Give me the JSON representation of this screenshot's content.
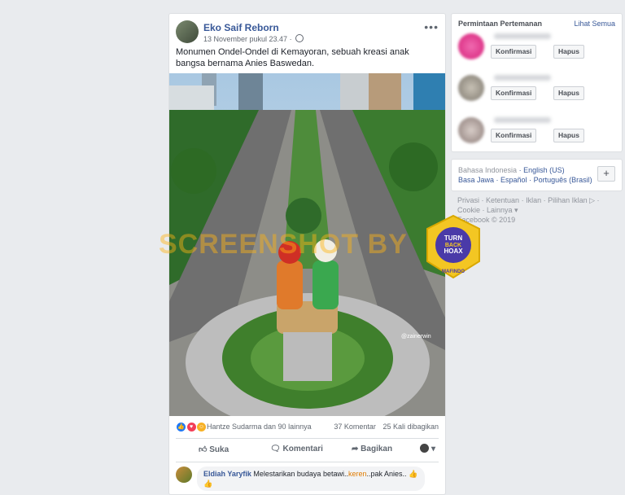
{
  "post": {
    "author": "Eko Saif Reborn",
    "timestamp": "13 November pukul 23.47 ·",
    "more_icon": "more-dots-icon",
    "text": "Monumen Ondel-Ondel di Kemayoran, sebuah kreasi anak bangsa bernama Anies Baswedan.",
    "photo_credit": "@zainerwin",
    "reactions": {
      "names": "Hantze Sudarma dan 90 lainnya",
      "comments": "37 Komentar",
      "shares": "25 Kali dibagikan"
    },
    "actions": {
      "like": "Suka",
      "comment": "Komentari",
      "share": "Bagikan"
    },
    "comment": {
      "author": "Eldiah Yaryfik",
      "text_before": "Melestarikan budaya betawi..",
      "keyword": "keren",
      "text_after": "..pak Anies.."
    }
  },
  "friend_requests": {
    "title": "Permintaan Pertemanan",
    "see_all": "Lihat Semua",
    "confirm_label": "Konfirmasi",
    "delete_label": "Hapus"
  },
  "languages": {
    "current": "Bahasa Indonesia",
    "items": [
      "English (US)",
      "Basa Jawa",
      "Español",
      "Português (Brasil)"
    ],
    "plus": "+"
  },
  "footer": {
    "links": [
      "Privasi",
      "Ketentuan",
      "Iklan",
      "Pilihan Iklan",
      "Cookie",
      "Lainnya"
    ],
    "copyright": "Facebook © 2019"
  },
  "overlay": {
    "watermark": "SCREENSHOT BY",
    "badge_line1": "TURN",
    "badge_line2": "BACK",
    "badge_line3": "HOAX",
    "badge_org": "MAFINDO"
  },
  "colors": {
    "fb_blue": "#385898",
    "like_blue": "#2078f4",
    "love_red": "#f33e58",
    "haha_yellow": "#f7b125"
  }
}
